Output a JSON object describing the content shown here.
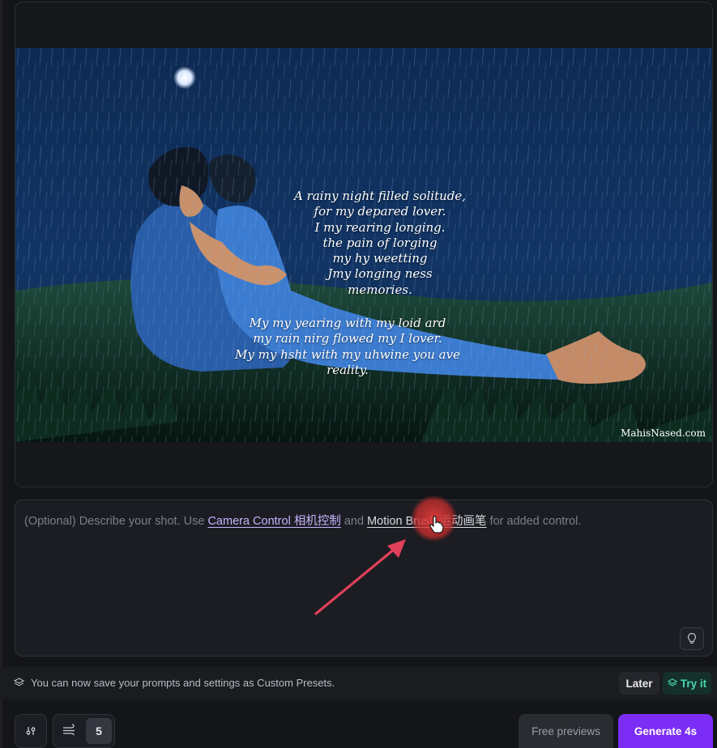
{
  "image": {
    "poem_stanza_1": [
      "A rainy night filled solitude,",
      "for my depared lover.",
      "I my rearing longing.",
      "the pain of lorging",
      "my hy weetting",
      "Jmy longing ness",
      "memories."
    ],
    "poem_stanza_2": [
      "My my yearing with my loid ard",
      "my rain nirg flowed my I lover.",
      "My my hsht  with my uhwine you ave",
      "reality."
    ],
    "watermark": "MahisNased.com"
  },
  "prompt": {
    "lead": "(Optional) Describe your shot. Use ",
    "camera_control_link": "Camera Control 相机控制",
    "and": " and ",
    "motion_brush_link": "Motion Brush 运动画笔",
    "tail": " for added control."
  },
  "presets_bar": {
    "message": "You can now save your prompts and settings as Custom Presets.",
    "later_label": "Later",
    "try_label": "Try it"
  },
  "toolbar": {
    "motion_count": "5",
    "free_previews_label": "Free previews",
    "generate_label": "Generate 4s"
  },
  "colors": {
    "accent_purple": "#7b2cf5",
    "try_green": "#47d6b0",
    "annotation_red": "#e0405a"
  }
}
